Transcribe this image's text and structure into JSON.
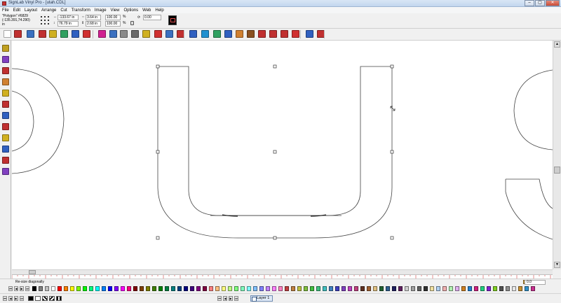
{
  "window": {
    "title": "SignLab Vinyl Pro - [utah.CDL]",
    "controls": {
      "minimize": "–",
      "maximize": "▢",
      "close": "✕"
    }
  },
  "menu": [
    "File",
    "Edit",
    "Layout",
    "Arrange",
    "Cut",
    "Transform",
    "Image",
    "View",
    "Options",
    "Web",
    "Help"
  ],
  "object_info": {
    "name": "\"Polygon\" #6829",
    "coords": "(-135.391,74.290)",
    "unit": "in",
    "x_value": "-133.67 in",
    "y_value": "76.79 in",
    "width_value": "3.64 in",
    "height_value": "2.68 in",
    "scale_x": "100.00",
    "scale_y": "100.00",
    "rotation": "0.00",
    "pct_symbol": "%"
  },
  "status": {
    "message": "Re-size diagonally",
    "coord_readout": "0.0"
  },
  "layer": {
    "label": "Layer 1"
  },
  "nav": {
    "first": "⏮",
    "prev": "◀",
    "next": "▶",
    "last": "⏭"
  },
  "colors": {
    "palette": [
      "#000000",
      "#7f7f7f",
      "#c0c0c0",
      "#ffffff",
      "#ff0000",
      "#ff8000",
      "#ffff00",
      "#80ff00",
      "#00ff00",
      "#00ff80",
      "#00ffff",
      "#0080ff",
      "#0000ff",
      "#8000ff",
      "#ff00ff",
      "#ff0080",
      "#800000",
      "#804000",
      "#808000",
      "#408000",
      "#008000",
      "#008040",
      "#008080",
      "#004080",
      "#000080",
      "#400080",
      "#800080",
      "#800040",
      "#ff8080",
      "#ffc080",
      "#ffff80",
      "#c0ff80",
      "#80ff80",
      "#80ffc0",
      "#80ffff",
      "#80c0ff",
      "#8080ff",
      "#c080ff",
      "#ff80ff",
      "#ff80c0",
      "#c04040",
      "#c08040",
      "#c0c040",
      "#80c040",
      "#40c040",
      "#40c080",
      "#40c0c0",
      "#4080c0",
      "#4040c0",
      "#8040c0",
      "#c040c0",
      "#c04080",
      "#603020",
      "#a06030",
      "#e0c080",
      "#206030",
      "#306090",
      "#202060",
      "#602060",
      "#d0d0d0",
      "#a0a0a0",
      "#606060",
      "#303030",
      "#f0e0a0",
      "#b0d0f0",
      "#f0b0b0",
      "#b0f0b0",
      "#e0b0f0",
      "#d08020",
      "#2080d0",
      "#d02080",
      "#20d080",
      "#8020d0",
      "#80d020",
      "#505050",
      "#909090",
      "#e8e8e8",
      "#c89030",
      "#3090c8",
      "#c83090"
    ],
    "toolbar_icons": [
      "#ffffff",
      "#c03030",
      "#3a70c0",
      "#c03030",
      "#d0b020",
      "#30a060",
      "#3060c0",
      "#d03030",
      "#d02090",
      "#3a70c0",
      "#8a8a8a",
      "#6a6a6a",
      "#d0b020",
      "#d03030",
      "#3a70c0",
      "#c03030",
      "#3060c0",
      "#2090d0",
      "#30a060",
      "#3060c0",
      "#d08030",
      "#8a5020",
      "#c03030",
      "#c03030",
      "#c03030",
      "#d03030",
      "#3060c0",
      "#c03030"
    ],
    "left_tool_icons": [
      "#c0a020",
      "#8040c0",
      "#c03030",
      "#d08030",
      "#d0b020",
      "#c03030",
      "#3060c0",
      "#c03030",
      "#d0b020",
      "#3060c0",
      "#c03030",
      "#8040c0"
    ]
  }
}
